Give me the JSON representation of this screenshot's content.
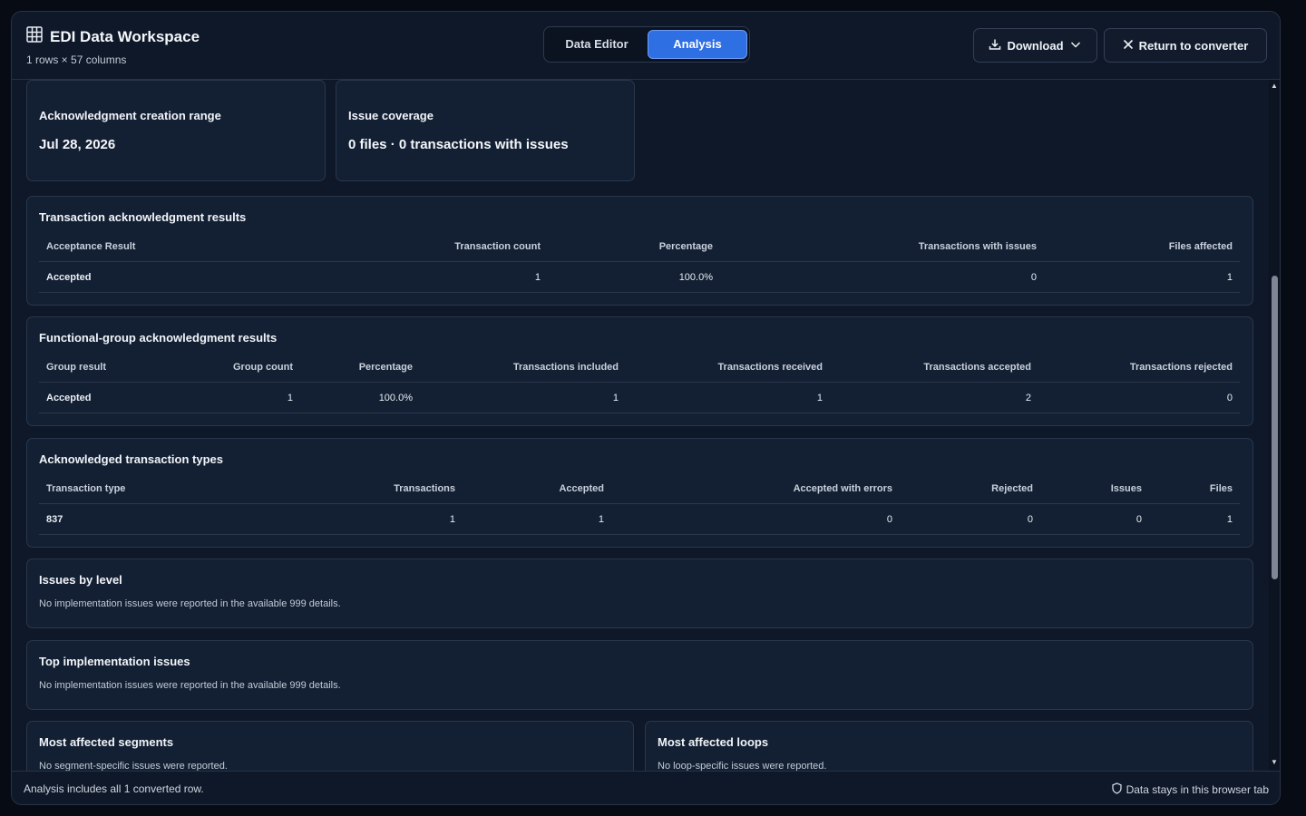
{
  "header": {
    "title": "EDI Data Workspace",
    "subtitle": "1 rows × 57 columns",
    "tabs": [
      {
        "label": "Data Editor",
        "active": false
      },
      {
        "label": "Analysis",
        "active": true
      }
    ],
    "download_label": "Download",
    "return_label": "Return to converter"
  },
  "summary": {
    "range_title": "Acknowledgment creation range",
    "range_value": "Jul 28, 2026",
    "coverage_title": "Issue coverage",
    "coverage_value": "0 files · 0 transactions with issues"
  },
  "transaction_results": {
    "title": "Transaction acknowledgment results",
    "columns": [
      "Acceptance Result",
      "Transaction count",
      "Percentage",
      "Transactions with issues",
      "Files affected"
    ],
    "rows": [
      [
        "Accepted",
        "1",
        "100.0%",
        "0",
        "1"
      ]
    ]
  },
  "group_results": {
    "title": "Functional-group acknowledgment results",
    "columns": [
      "Group result",
      "Group count",
      "Percentage",
      "Transactions included",
      "Transactions received",
      "Transactions accepted",
      "Transactions rejected"
    ],
    "rows": [
      [
        "Accepted",
        "1",
        "100.0%",
        "1",
        "1",
        "2",
        "0"
      ]
    ]
  },
  "transaction_types": {
    "title": "Acknowledged transaction types",
    "columns": [
      "Transaction type",
      "Transactions",
      "Accepted",
      "Accepted with errors",
      "Rejected",
      "Issues",
      "Files"
    ],
    "rows": [
      [
        "837",
        "1",
        "1",
        "0",
        "0",
        "0",
        "1"
      ]
    ]
  },
  "issues_by_level": {
    "title": "Issues by level",
    "note": "No implementation issues were reported in the available 999 details."
  },
  "top_issues": {
    "title": "Top implementation issues",
    "note": "No implementation issues were reported in the available 999 details."
  },
  "segments": {
    "title": "Most affected segments",
    "note": "No segment-specific issues were reported."
  },
  "loops": {
    "title": "Most affected loops",
    "note": "No loop-specific issues were reported."
  },
  "footer": {
    "left": "Analysis includes all 1 converted row.",
    "right": "Data stays in this browser tab"
  },
  "colors": {
    "background": "#0f1828",
    "card": "#132033",
    "accent": "#2f6fe4"
  },
  "icons": [
    "table-grid-icon",
    "download-icon",
    "chevron-down-icon",
    "close-icon",
    "shield-icon"
  ]
}
